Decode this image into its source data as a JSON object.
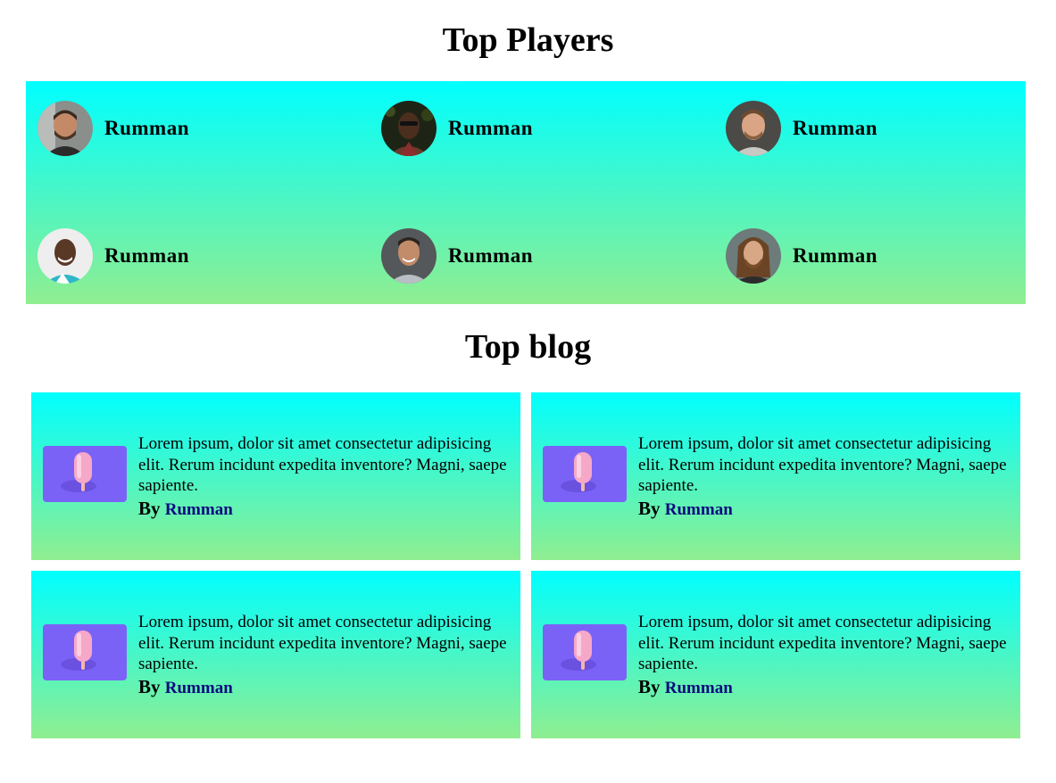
{
  "sections": {
    "players_title": "Top Players",
    "blog_title": "Top blog"
  },
  "players": [
    {
      "name": "Rumman",
      "avatar": "man-beard-smiling-avatar"
    },
    {
      "name": "Rumman",
      "avatar": "man-dark-skin-avatar"
    },
    {
      "name": "Rumman",
      "avatar": "man-smiling-avatar"
    },
    {
      "name": "Rumman",
      "avatar": "man-laughing-avatar"
    },
    {
      "name": "Rumman",
      "avatar": "man-suit-smiling-avatar"
    },
    {
      "name": "Rumman",
      "avatar": "man-long-hair-avatar"
    }
  ],
  "blogs": [
    {
      "text": "Lorem ipsum, dolor sit amet consectetur adipisicing elit. Rerum incidunt expedita inventore? Magni, saepe sapiente.",
      "by_label": "By",
      "author": "Rumman",
      "thumbnail": "popsicle-illustration"
    },
    {
      "text": "Lorem ipsum, dolor sit amet consectetur adipisicing elit. Rerum incidunt expedita inventore? Magni, saepe sapiente.",
      "by_label": "By",
      "author": "Rumman",
      "thumbnail": "popsicle-illustration"
    },
    {
      "text": "Lorem ipsum, dolor sit amet consectetur adipisicing elit. Rerum incidunt expedita inventore? Magni, saepe sapiente.",
      "by_label": "By",
      "author": "Rumman",
      "thumbnail": "popsicle-illustration"
    },
    {
      "text": "Lorem ipsum, dolor sit amet consectetur adipisicing elit. Rerum incidunt expedita inventore? Magni, saepe sapiente.",
      "by_label": "By",
      "author": "Rumman",
      "thumbnail": "popsicle-illustration"
    }
  ],
  "colors": {
    "gradient_top": "#00ffff",
    "gradient_bottom": "#90ee90",
    "thumbnail_bg": "#7b62f7",
    "author_link": "#0a0a80"
  }
}
